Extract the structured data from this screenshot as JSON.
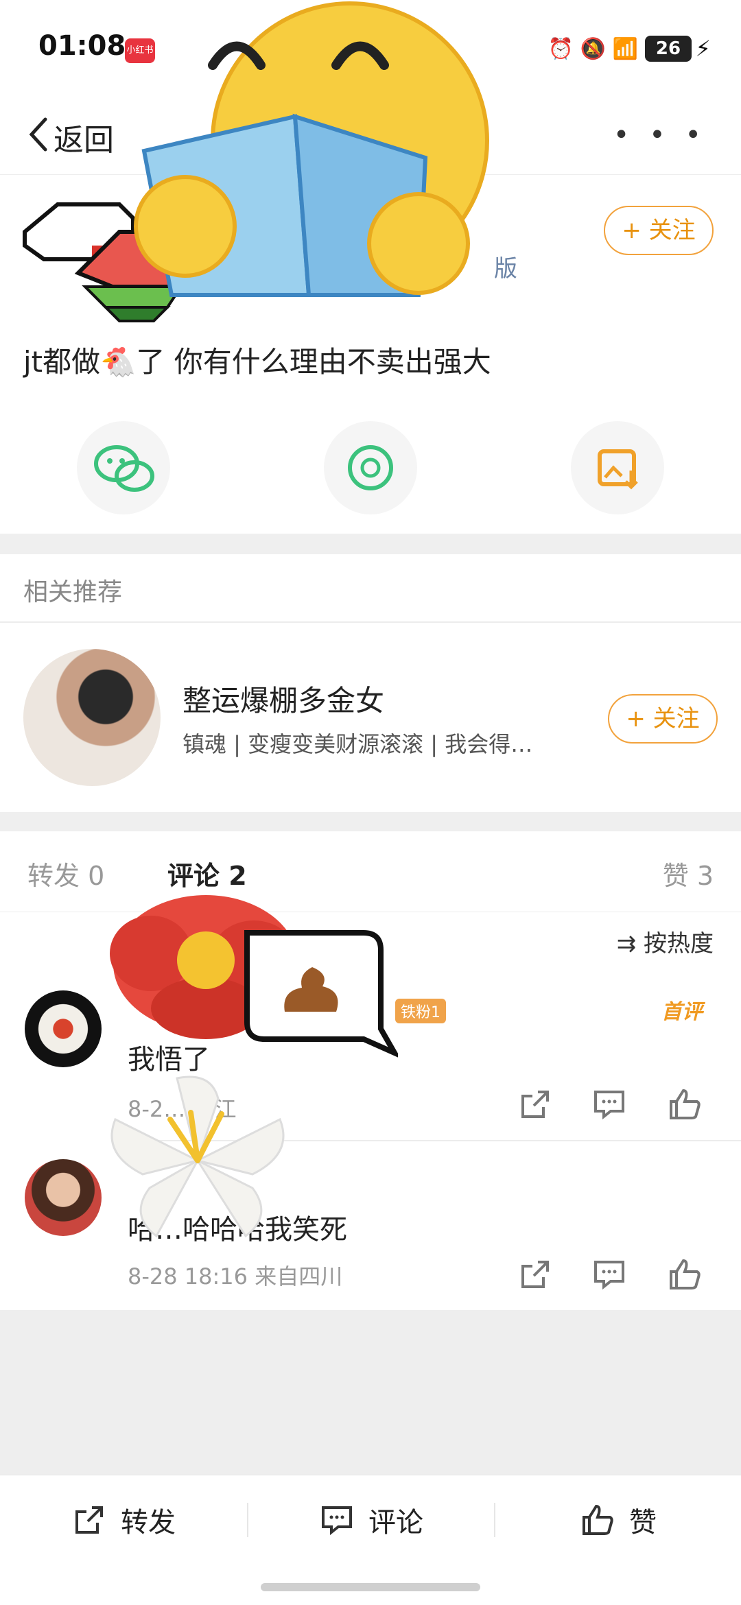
{
  "status_bar": {
    "time": "01:08",
    "app_badge": "小红书",
    "network": "5A",
    "battery": "26"
  },
  "navbar": {
    "back_label": "返回",
    "more": "• • •"
  },
  "post": {
    "version_tag": "版",
    "follow_label": "+ 关注",
    "text": "jt都做🐔了 你有什么理由不卖出强大"
  },
  "share": {
    "wechat": "wechat-icon",
    "moments": "moments-icon",
    "save_image": "save-image-icon"
  },
  "recommend": {
    "section_label": "相关推荐",
    "name": "整运爆棚多金女",
    "desc": "镇魂 | 变瘦变美财源滚滚 | 我会得…",
    "follow_label": "+ 关注"
  },
  "tabs": {
    "repost": "转发 0",
    "comment": "评论 2",
    "like": "赞 3"
  },
  "sort_label": "按热度",
  "comments": [
    {
      "fan_badge": "铁粉1",
      "first_tag": "首评",
      "text": "我悟了",
      "meta": "8-2… 浙江"
    },
    {
      "text": "哈…哈哈哈我笑死",
      "meta": "8-28 18:16 来自四川"
    }
  ],
  "bottom_bar": {
    "repost": "转发",
    "comment": "评论",
    "like": "赞"
  },
  "colors": {
    "accent": "#f2a23c",
    "divider": "#efefef"
  }
}
